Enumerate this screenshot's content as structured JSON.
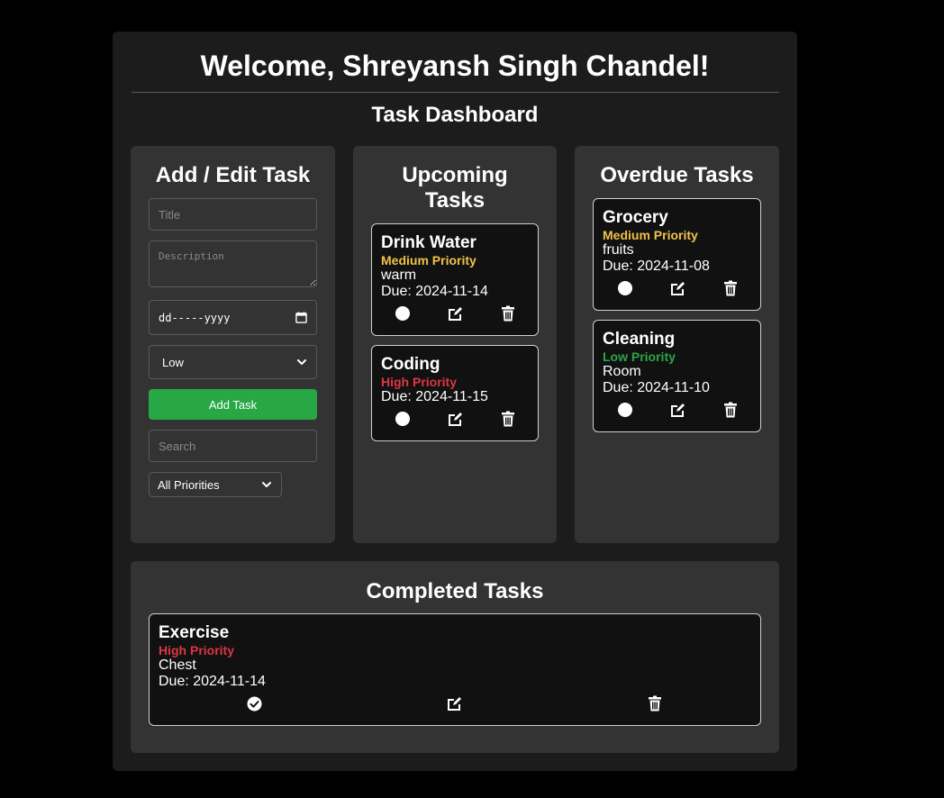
{
  "header": {
    "welcome": "Welcome, Shreyansh Singh Chandel!",
    "dashboard_title": "Task Dashboard"
  },
  "form": {
    "title": "Add / Edit Task",
    "title_placeholder": "Title",
    "description_placeholder": "Description",
    "date_placeholder": "dd-----yyyy",
    "priority_selected": "Low",
    "add_button": "Add Task",
    "search_placeholder": "Search",
    "filter_selected": "All Priorities"
  },
  "upcoming": {
    "title": "Upcoming Tasks",
    "tasks": [
      {
        "title": "Drink Water",
        "priority": "Medium Priority",
        "description": "warm",
        "due": "Due: 2024-11-14"
      },
      {
        "title": "Coding",
        "priority": "High Priority",
        "description": "",
        "due": "Due: 2024-11-15"
      }
    ]
  },
  "overdue": {
    "title": "Overdue Tasks",
    "tasks": [
      {
        "title": "Grocery",
        "priority": "Medium Priority",
        "description": "fruits",
        "due": "Due: 2024-11-08"
      },
      {
        "title": "Cleaning",
        "priority": "Low Priority",
        "description": "Room",
        "due": "Due: 2024-11-10"
      }
    ]
  },
  "completed": {
    "title": "Completed Tasks",
    "tasks": [
      {
        "title": "Exercise",
        "priority": "High Priority",
        "description": "Chest",
        "due": "Due: 2024-11-14"
      }
    ]
  },
  "colors": {
    "page_bg": "#000000",
    "container_bg": "#1c1c1c",
    "panel_bg": "#333333",
    "card_bg": "#111111",
    "add_button": "#28a745",
    "medium_priority": "#f0c246",
    "high_priority": "#dc3545",
    "low_priority": "#28a745"
  },
  "icons": [
    "complete-toggle-icon",
    "check-circle-icon",
    "edit-icon",
    "trash-icon",
    "chevron-down-icon",
    "calendar-icon"
  ]
}
